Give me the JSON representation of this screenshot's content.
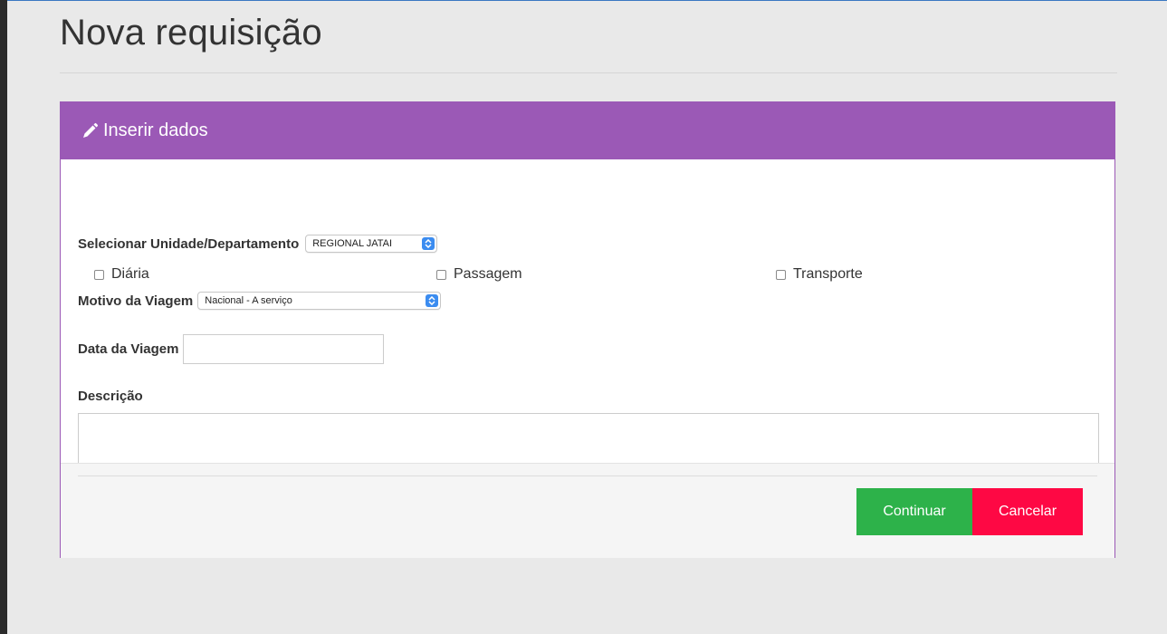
{
  "page": {
    "title": "Nova requisição"
  },
  "panel": {
    "heading": "Inserir dados",
    "heading_icon": "pencil-icon",
    "accent_color": "#9b59b6"
  },
  "form": {
    "unit_label": "Selecionar Unidade/Departamento",
    "unit_value": "REGIONAL JATAI",
    "checkboxes": [
      {
        "label": "Diária",
        "checked": false
      },
      {
        "label": "Passagem",
        "checked": false
      },
      {
        "label": "Transporte",
        "checked": false
      }
    ],
    "reason_label": "Motivo da Viagem",
    "reason_value": "Nacional - A serviço",
    "date_label": "Data da Viagem",
    "date_value": "",
    "description_label": "Descrição",
    "description_value": ""
  },
  "actions": {
    "continue_label": "Continuar",
    "continue_color": "#2db24a",
    "cancel_label": "Cancelar",
    "cancel_color": "#fe0844"
  }
}
